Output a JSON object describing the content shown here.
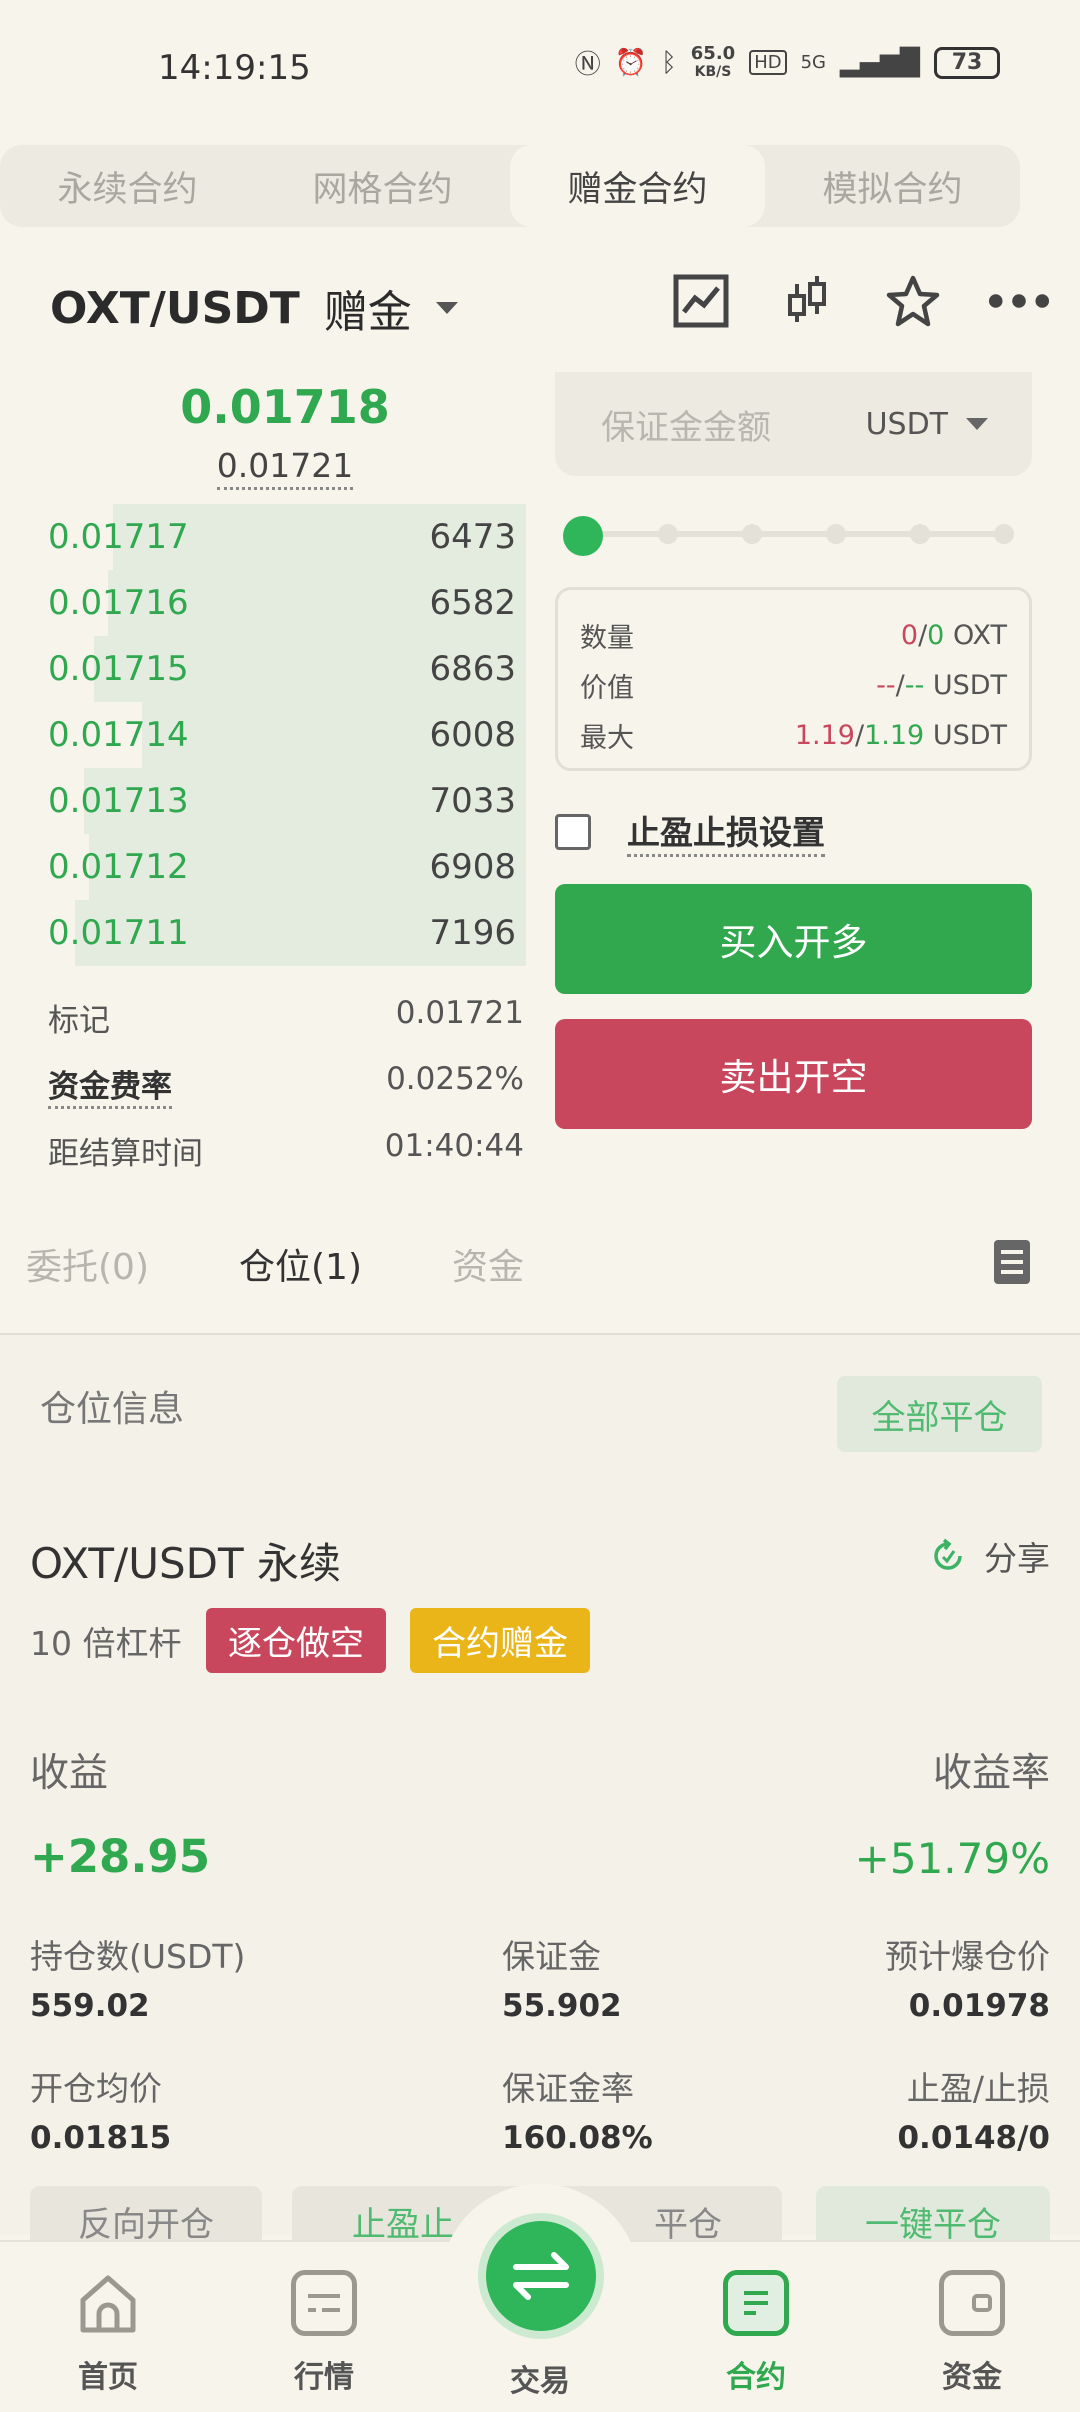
{
  "status_bar": {
    "time": "14:19:15",
    "net_speed": "65.0",
    "net_unit": "KB/S",
    "hd": "HD",
    "signal": "5G",
    "battery": "73"
  },
  "top_tabs": [
    "永续合约",
    "网格合约",
    "赠金合约",
    "模拟合约"
  ],
  "active_top_tab": 2,
  "header": {
    "pair": "OXT/USDT",
    "mode": "赠金"
  },
  "orderbook": {
    "last_price": "0.01718",
    "mark_price": "0.01721",
    "rows": [
      {
        "price": "0.01717",
        "qty": "6473",
        "depth": 0.86
      },
      {
        "price": "0.01716",
        "qty": "6582",
        "depth": 0.87
      },
      {
        "price": "0.01715",
        "qty": "6863",
        "depth": 0.9
      },
      {
        "price": "0.01714",
        "qty": "6008",
        "depth": 0.8
      },
      {
        "price": "0.01713",
        "qty": "7033",
        "depth": 0.92
      },
      {
        "price": "0.01712",
        "qty": "6908",
        "depth": 0.91
      },
      {
        "price": "0.01711",
        "qty": "7196",
        "depth": 0.94
      }
    ],
    "mark_label": "标记",
    "mark_value": "0.01721",
    "funding_label": "资金费率",
    "funding_value": "0.0252%",
    "settle_label": "距结算时间",
    "settle_value": "01:40:44"
  },
  "form": {
    "margin_placeholder": "保证金金额",
    "margin_unit": "USDT",
    "slider_level": 0,
    "qty_label": "数量",
    "qty_a": "0",
    "qty_sep": "/",
    "qty_b": "0",
    "qty_unit": "OXT",
    "value_label": "价值",
    "value_a": "--",
    "value_sep": "/",
    "value_b": "--",
    "value_unit": "USDT",
    "max_label": "最大",
    "max_a": "1.19",
    "max_sep": "/",
    "max_b": "1.19",
    "max_unit": "USDT",
    "tpsl_label": "止盈止损设置",
    "buy_label": "买入开多",
    "sell_label": "卖出开空"
  },
  "position_tabs": {
    "orders": "委托(0)",
    "positions": "仓位(1)",
    "funds": "资金"
  },
  "position": {
    "section_label": "仓位信息",
    "close_all": "全部平仓",
    "title": "OXT/USDT 永续",
    "share": "分享",
    "leverage": "10 倍杠杆",
    "badge_short": "逐仓做空",
    "badge_bonus": "合约赠金",
    "pnl_label": "收益",
    "pnl_rate_label": "收益率",
    "pnl": "+28.95",
    "pnl_rate": "+51.79%",
    "stats": [
      {
        "label": "持仓数(USDT)",
        "value": "559.02"
      },
      {
        "label": "保证金",
        "value": "55.902"
      },
      {
        "label": "预计爆仓价",
        "value": "0.01978"
      },
      {
        "label": "开仓均价",
        "value": "0.01815"
      },
      {
        "label": "保证金率",
        "value": "160.08%"
      },
      {
        "label": "止盈/止损",
        "value": "0.0148/0"
      }
    ],
    "buttons": [
      "反向开仓",
      "止盈止",
      "平仓",
      "一键平仓"
    ]
  },
  "nav": {
    "home": "首页",
    "market": "行情",
    "trade": "交易",
    "contract": "合约",
    "funds": "资金"
  }
}
